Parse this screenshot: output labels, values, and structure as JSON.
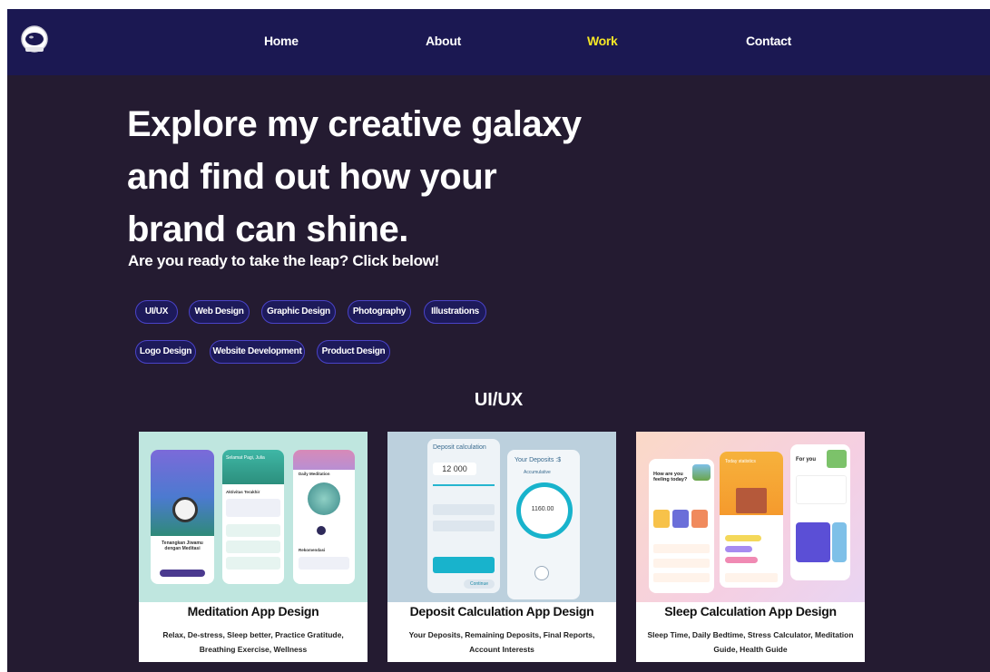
{
  "nav": {
    "links": [
      {
        "label": "Home",
        "active": false
      },
      {
        "label": "About",
        "active": false
      },
      {
        "label": "Work",
        "active": true
      },
      {
        "label": "Contact",
        "active": false
      }
    ],
    "logo_icon": "astronaut-helmet-icon",
    "active_color": "#f5e626"
  },
  "hero": {
    "title": "Explore my creative galaxy and find out how your brand can shine.",
    "subtitle": "Are you ready to take the leap? Click below!"
  },
  "categories": [
    "UI/UX",
    "Web Design",
    "Graphic Design",
    "Photography",
    "Illustrations",
    "Logo Design",
    "Website Development",
    "Product Design"
  ],
  "section": {
    "title": "UI/UX"
  },
  "cards": [
    {
      "title": "Meditation App Design",
      "description": "Relax, De-stress, Sleep better, Practice Gratitude, Breathing Exercise, Wellness",
      "image_texts": [
        "Selamat Pagi, Julia",
        "Daily Meditation",
        "Tenangkan Jiwamu dengan Meditasi",
        "Aktivitas Terakhir",
        "Rekomendasi"
      ]
    },
    {
      "title": "Deposit Calculation App Design",
      "description": "Your Deposits, Remaining Deposits, Final Reports, Account Interests",
      "image_texts": [
        "Deposit calculation",
        "12 000",
        "Your Deposits :$",
        "Accumulative",
        "1160.00",
        "Continue"
      ]
    },
    {
      "title": "Sleep Calculation App Design",
      "description": "Sleep Time, Daily Bedtime, Stress Calculator, Meditation Guide, Health Guide",
      "image_texts": [
        "How are you feeling today?",
        "Today statistics",
        "For you"
      ]
    }
  ],
  "colors": {
    "page_bg": "#241b31",
    "nav_bg": "#1b1852",
    "chip_border": "#4a43c8",
    "chip_bg": "#1d1a5a"
  }
}
